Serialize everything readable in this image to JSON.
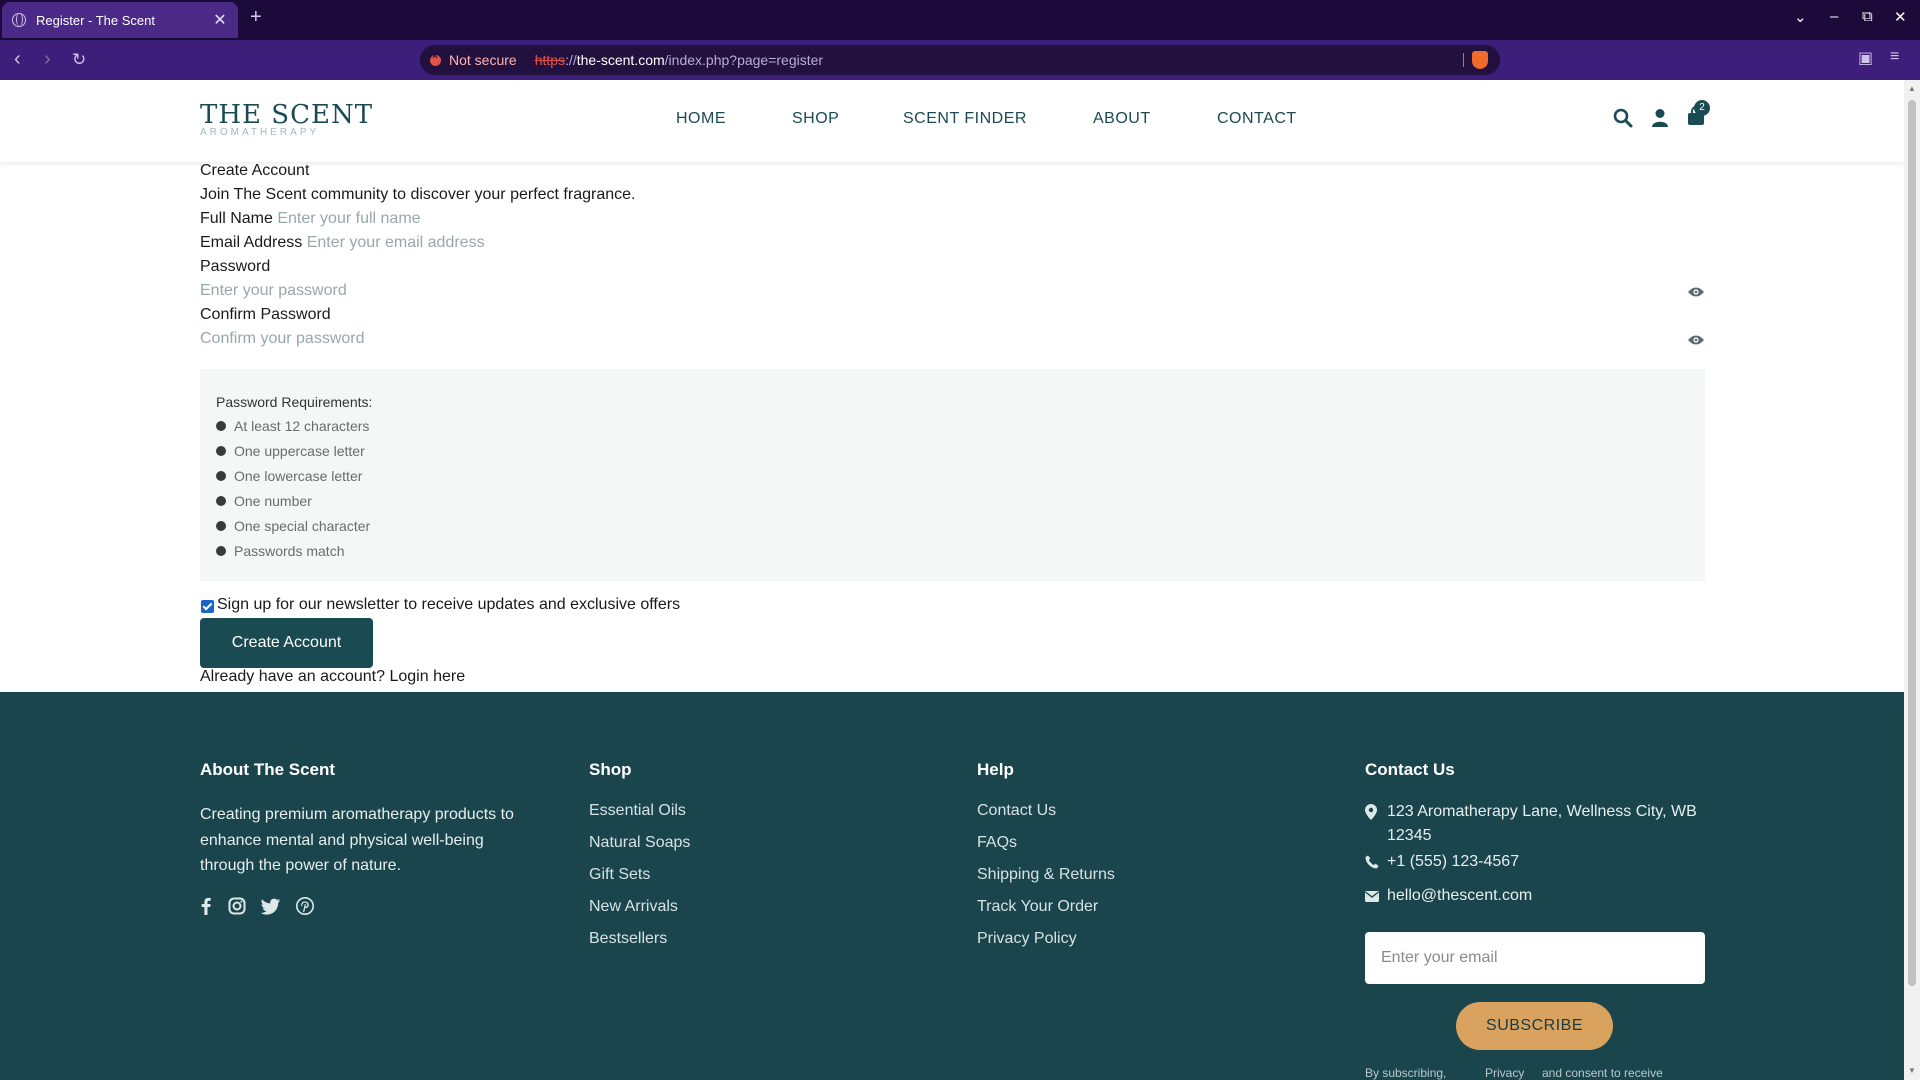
{
  "browser": {
    "tab_title": "Register - The Scent",
    "tab_close": "✕",
    "new_tab": "+",
    "security_label": "Not secure",
    "url_scheme": "https",
    "url_sep": "://",
    "url_host": "the-scent.com",
    "url_path": "/index.php?page=register"
  },
  "header": {
    "logo": "THE SCENT",
    "logo_sub": "AROMATHERAPY",
    "nav": [
      "HOME",
      "SHOP",
      "SCENT FINDER",
      "ABOUT",
      "CONTACT"
    ],
    "cart_count": "2"
  },
  "form": {
    "title": "Create Account",
    "subtitle": "Join The Scent community to discover your perfect fragrance.",
    "full_name_label": "Full Name",
    "full_name_placeholder": "Enter your full name",
    "email_label": "Email Address",
    "email_placeholder": "Enter your email address",
    "password_label": "Password",
    "password_placeholder": "Enter your password",
    "confirm_label": "Confirm Password",
    "confirm_placeholder": "Confirm your password",
    "requirements_title": "Password Requirements:",
    "requirements": [
      "At least 12 characters",
      "One uppercase letter",
      "One lowercase letter",
      "One number",
      "One special character",
      "Passwords match"
    ],
    "newsletter_checked": true,
    "newsletter_label": "Sign up for our newsletter to receive updates and exclusive offers",
    "submit_label": "Create Account",
    "login_prompt": "Already have an account?",
    "login_link": "Login here"
  },
  "footer": {
    "about_title": "About The Scent",
    "about_text": "Creating premium aromatherapy products to enhance mental and physical well-being through the power of nature.",
    "shop_title": "Shop",
    "shop_links": [
      "Essential Oils",
      "Natural Soaps",
      "Gift Sets",
      "New Arrivals",
      "Bestsellers"
    ],
    "help_title": "Help",
    "help_links": [
      "Contact Us",
      "FAQs",
      "Shipping & Returns",
      "Track Your Order",
      "Privacy Policy"
    ],
    "contact_title": "Contact Us",
    "address": "123 Aromatherapy Lane, Wellness City, WB 12345",
    "phone": "+1 (555) 123-4567",
    "email": "hello@thescent.com",
    "subscribe_placeholder": "Enter your email",
    "subscribe_label": "SUBSCRIBE",
    "fine_print_1": "By subscribing,",
    "fine_print_2": "Privacy",
    "fine_print_3": "and consent to receive"
  },
  "colors": {
    "brand": "#1a4a52",
    "footer_bg": "#1a454d",
    "accent": "#d9a35f",
    "chrome_tabbar": "#1c0b3a",
    "chrome_addrbar": "#3d1e7a"
  }
}
